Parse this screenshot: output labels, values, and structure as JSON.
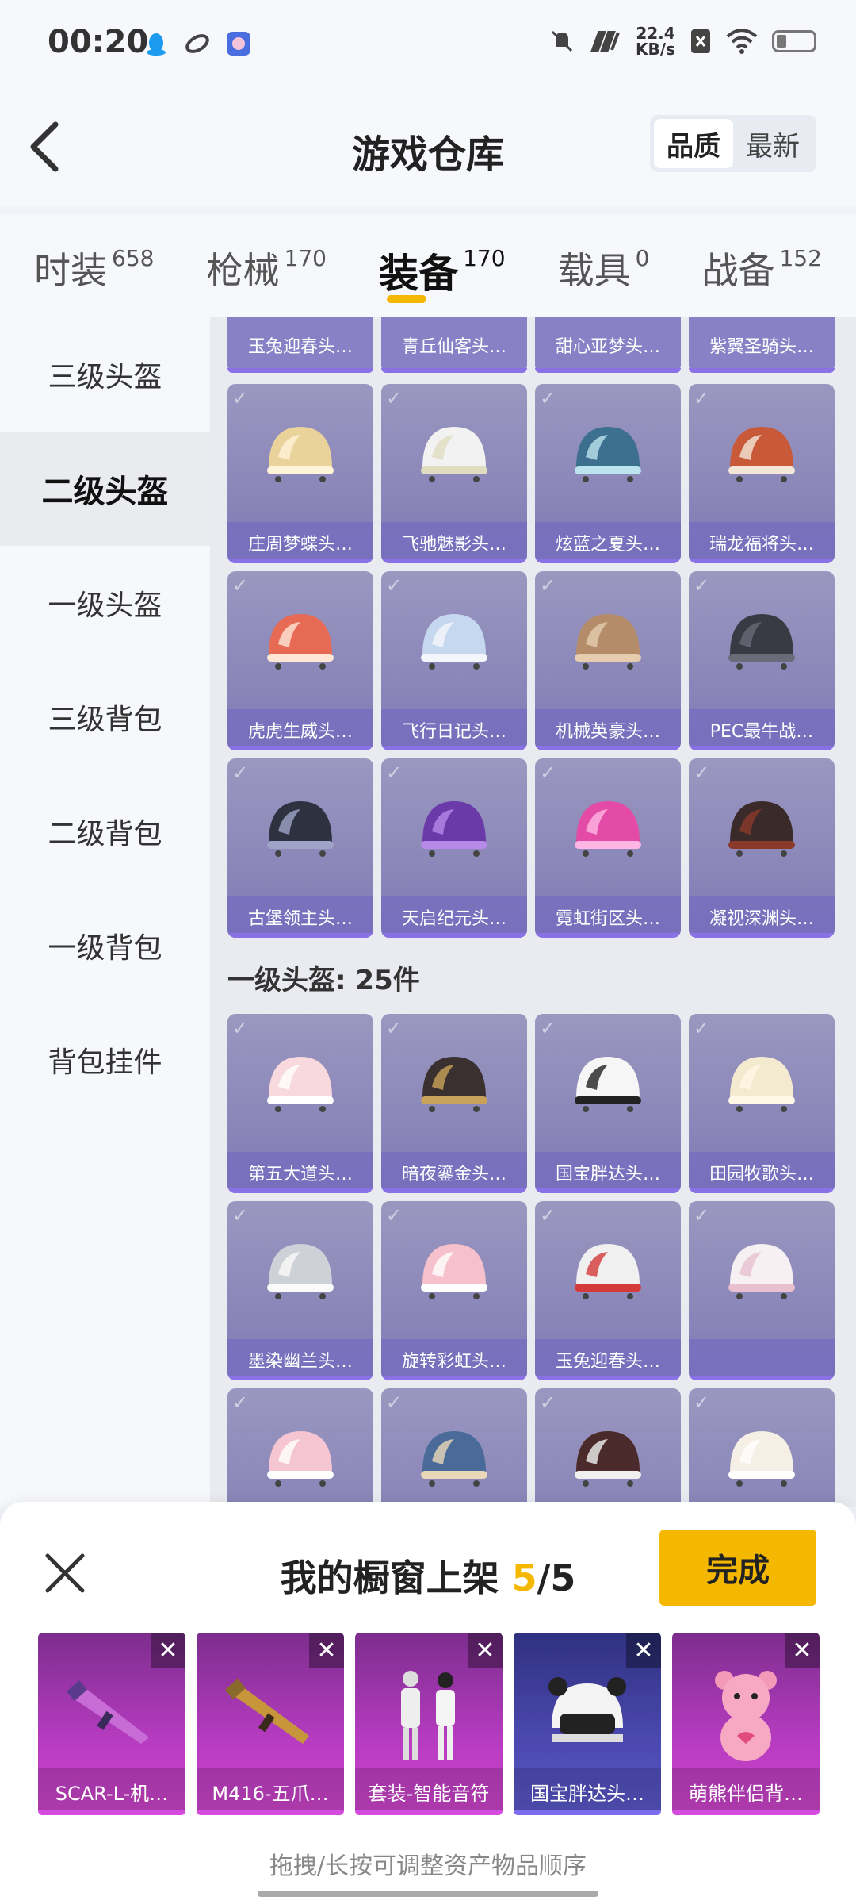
{
  "status_bar": {
    "time": "00:20",
    "speed_value": "22.4",
    "speed_unit": "KB/s"
  },
  "header": {
    "title": "游戏仓库",
    "sort_options": [
      "品质",
      "最新"
    ],
    "sort_active": 0
  },
  "category_tabs": [
    {
      "name": "时装",
      "count": "658"
    },
    {
      "name": "枪械",
      "count": "170"
    },
    {
      "name": "装备",
      "count": "170",
      "active": true
    },
    {
      "name": "载具",
      "count": "0"
    },
    {
      "name": "战备",
      "count": "152"
    }
  ],
  "sidebar": [
    "三级头盔",
    "二级头盔",
    "一级头盔",
    "三级背包",
    "二级背包",
    "一级背包",
    "背包挂件"
  ],
  "sidebar_active": 1,
  "top_strip": [
    "玉兔迎春头…",
    "青丘仙客头…",
    "甜心亚梦头…",
    "紫翼圣骑头…"
  ],
  "level2_items": [
    "庄周梦蝶头…",
    "飞驰魅影头…",
    "炫蓝之夏头…",
    "瑞龙福将头…",
    "虎虎生威头…",
    "飞行日记头…",
    "机械英豪头…",
    "PEC最牛战…",
    "古堡领主头…",
    "天启纪元头…",
    "霓虹街区头…",
    "凝视深渊头…"
  ],
  "level1_section": {
    "title": "一级头盔: 25件"
  },
  "level1_items": [
    "第五大道头…",
    "暗夜鎏金头…",
    "国宝胖达头…",
    "田园牧歌头…",
    "墨染幽兰头…",
    "旋转彩虹头…",
    "玉兔迎春头…",
    "",
    "",
    "",
    "",
    ""
  ],
  "sheet": {
    "title_prefix": "我的橱窗上架 ",
    "count_current": "5",
    "count_total": "/5",
    "done_label": "完成",
    "hint": "拖拽/长按可调整资产物品顺序",
    "items": [
      "SCAR-L-机…",
      "M416-五爪…",
      "套装-智能音符",
      "国宝胖达头…",
      "萌熊伴侣背…"
    ]
  },
  "colors": {
    "accent": "#f5b800",
    "card": "#8884b8"
  }
}
